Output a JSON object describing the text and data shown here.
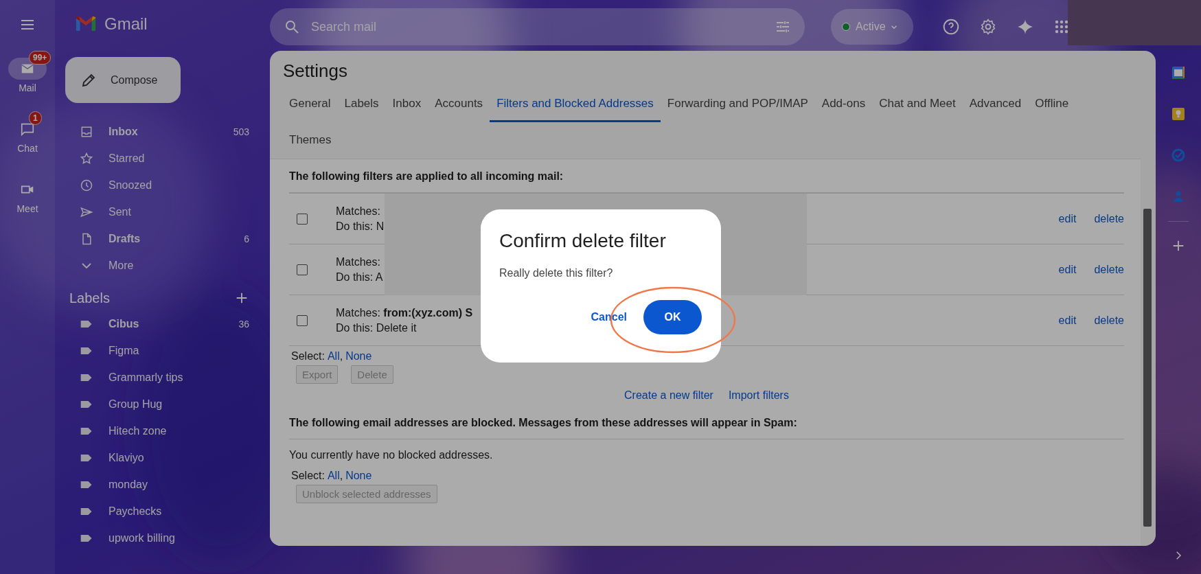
{
  "app_name": "Gmail",
  "rail": [
    {
      "label": "Mail",
      "badge": "99+",
      "selected": true,
      "kind": "mail"
    },
    {
      "label": "Chat",
      "badge": "1",
      "selected": false,
      "kind": "chat"
    },
    {
      "label": "Meet",
      "selected": false,
      "kind": "meet"
    }
  ],
  "compose": "Compose",
  "folders": [
    {
      "label": "Inbox",
      "count": "503",
      "unread": true,
      "kind": "inbox"
    },
    {
      "label": "Starred",
      "unread": false,
      "kind": "star"
    },
    {
      "label": "Snoozed",
      "unread": false,
      "kind": "clock"
    },
    {
      "label": "Sent",
      "unread": false,
      "kind": "send"
    },
    {
      "label": "Drafts",
      "count": "6",
      "unread": true,
      "kind": "file"
    },
    {
      "label": "More",
      "unread": false,
      "kind": "more"
    }
  ],
  "labels_header": "Labels",
  "labels": [
    {
      "label": "Cibus",
      "count": "36",
      "unread": true
    },
    {
      "label": "Figma",
      "unread": false
    },
    {
      "label": "Grammarly tips",
      "unread": false
    },
    {
      "label": "Group Hug",
      "unread": false
    },
    {
      "label": "Hitech zone",
      "unread": false
    },
    {
      "label": "Klaviyo",
      "unread": false
    },
    {
      "label": "monday",
      "unread": false
    },
    {
      "label": "Paychecks",
      "unread": false
    },
    {
      "label": "upwork billing",
      "unread": false
    }
  ],
  "search": {
    "placeholder": "Search mail"
  },
  "status": "Active",
  "settings": {
    "title": "Settings",
    "tabs": [
      {
        "label": "General",
        "selected": false
      },
      {
        "label": "Labels",
        "selected": false
      },
      {
        "label": "Inbox",
        "selected": false
      },
      {
        "label": "Accounts",
        "selected": false
      },
      {
        "label": "Filters and Blocked Addresses",
        "selected": true
      },
      {
        "label": "Forwarding and POP/IMAP",
        "selected": false
      },
      {
        "label": "Add-ons",
        "selected": false
      },
      {
        "label": "Chat and Meet",
        "selected": false
      },
      {
        "label": "Advanced",
        "selected": false
      },
      {
        "label": "Offline",
        "selected": false
      },
      {
        "label": "Themes",
        "selected": false
      }
    ],
    "filters_heading": "The following filters are applied to all incoming mail:",
    "filters": [
      {
        "matches": "Matches:",
        "action": "Do this: N",
        "checked": false,
        "edit": "edit",
        "delete": "delete"
      },
      {
        "matches": "Matches:",
        "action": "Do this: A",
        "checked": false,
        "edit": "edit",
        "delete": "delete"
      },
      {
        "matches": "Matches: **from:(xyz.com) S**",
        "action": "Do this: Delete it",
        "checked": false,
        "edit": "edit",
        "delete": "delete"
      }
    ],
    "filter_select": {
      "label": "Select:",
      "all": "All",
      "separator": ",",
      "none": "None"
    },
    "filter_buttons": [
      {
        "label": "Export",
        "disabled": true
      },
      {
        "label": "Delete",
        "disabled": true
      }
    ],
    "filter_links": [
      "Create a new filter",
      "Import filters"
    ],
    "blocked_heading": "The following email addresses are blocked. Messages from these addresses will appear in Spam:",
    "blocked_message": "You currently have no blocked addresses.",
    "blocked_select": {
      "label": "Select:",
      "all": "All",
      "separator": ",",
      "none": "None"
    },
    "blocked_button": {
      "label": "Unblock selected addresses",
      "disabled": true
    }
  },
  "dialog": {
    "title": "Confirm delete filter",
    "message": "Really delete this filter?",
    "cancel": "Cancel",
    "ok": "OK"
  }
}
